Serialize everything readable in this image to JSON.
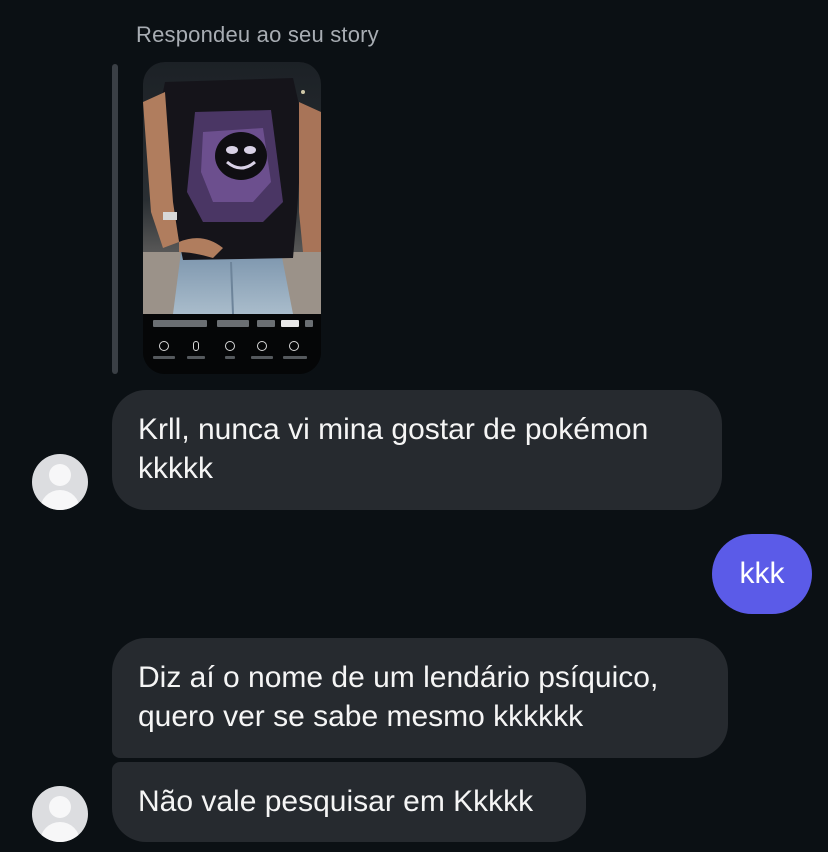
{
  "story_reply": {
    "label": "Respondeu ao seu story"
  },
  "messages": [
    {
      "sender": "them",
      "text": "Krll, nunca vi mina gostar de pokémon kkkkk"
    },
    {
      "sender": "me",
      "text": "kkk"
    },
    {
      "sender": "them",
      "text": "Diz aí o nome de um lendário psíquico, quero ver se sabe mesmo kkkkkk"
    },
    {
      "sender": "them",
      "text": "Não vale pesquisar em Kkkkk"
    }
  ],
  "colors": {
    "background": "#0b1014",
    "incoming_bubble": "#262a2f",
    "outgoing_bubble": "#5b5be8",
    "secondary_text": "#a8adb3"
  },
  "icons": {
    "avatar": "default-user-avatar-icon"
  }
}
